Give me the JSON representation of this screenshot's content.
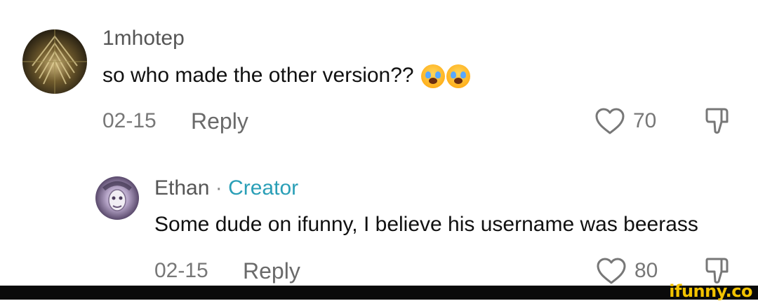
{
  "comment1": {
    "username": "1mhotep",
    "text": "so who made the other version??",
    "date": "02-15",
    "reply_label": "Reply",
    "likes": "70",
    "emojis": [
      "loudly-crying-face",
      "loudly-crying-face"
    ]
  },
  "comment2": {
    "username": "Ethan",
    "separator": "·",
    "creator_badge": "Creator",
    "text": "Some dude on ifunny, I believe his username was beerass",
    "date": "02-15",
    "reply_label": "Reply",
    "likes": "80"
  },
  "watermark": "ifunny.co",
  "colors": {
    "creator": "#2a9fb7",
    "watermark": "#f2c200",
    "meta_text": "#777777"
  }
}
